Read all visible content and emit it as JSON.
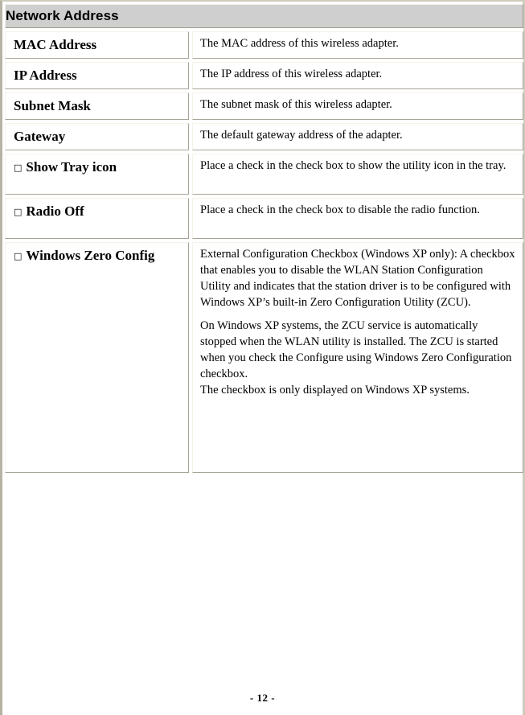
{
  "page": {
    "section_title": "Network Address",
    "footer": "- 12 -"
  },
  "icons": {
    "checkbox_empty": "□"
  },
  "table": {
    "rows": [
      {
        "label": "MAC Address",
        "has_checkbox": false,
        "description": "The MAC address of this wireless adapter."
      },
      {
        "label": "IP Address",
        "has_checkbox": false,
        "description": "The IP address of this wireless adapter."
      },
      {
        "label": "Subnet Mask",
        "has_checkbox": false,
        "description": "The subnet mask of this wireless adapter."
      },
      {
        "label": "Gateway",
        "has_checkbox": false,
        "description": "The default gateway address of the adapter."
      },
      {
        "label": "Show Tray icon",
        "has_checkbox": true,
        "description": "Place a check in the check box to show the utility icon in the tray."
      },
      {
        "label": "Radio Off",
        "has_checkbox": true,
        "description": "Place a check in the check box to disable the radio function."
      },
      {
        "label": "Windows Zero Config",
        "has_checkbox": true,
        "paragraphs": [
          "External Configuration Checkbox (Windows XP only): A checkbox that enables you to disable the WLAN Station Configuration Utility and indicates that the station driver is to be configured with Windows XP’s built-in Zero Configuration Utility (ZCU).",
          "On Windows XP systems, the ZCU service is automatically stopped when the WLAN utility is installed. The ZCU is started when you check the Configure using Windows Zero Configuration checkbox.",
          "The checkbox is only displayed on Windows XP systems."
        ]
      }
    ]
  },
  "colors": {
    "header_background": "#cfcfcf",
    "cell_border_light": "#f5f3e9",
    "cell_border_dark": "#a8a496",
    "page_frame": "#b7b3a3",
    "text": "#000000"
  }
}
